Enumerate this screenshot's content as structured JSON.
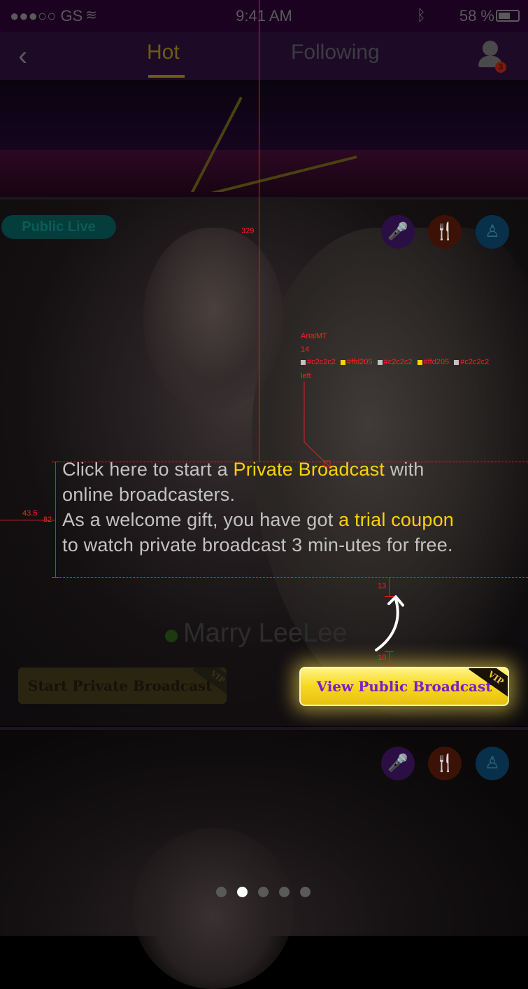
{
  "status_bar": {
    "carrier": "●●●○○ GS",
    "time": "9:41 AM",
    "battery": "58 %"
  },
  "nav": {
    "back_icon": "chevron-left-icon",
    "tabs": [
      "Hot",
      "Following"
    ],
    "active_tab": "Hot",
    "user_badge": "3"
  },
  "feed": {
    "live_badge": "Public Live",
    "broadcaster_name": "Marry LeeLee",
    "category_icons": [
      "microphone-icon",
      "fork-knife-icon",
      "yoga-icon"
    ],
    "private_button": "Start Private Broadcast",
    "vip_label": "VIP"
  },
  "guide": {
    "seg1": "Click here to start a ",
    "seg2": "Private Broadcast",
    "seg3": " with online broadcasters.",
    "seg4": "As a welcome gift, you have got ",
    "seg5": "a trial coupon",
    "seg6": " to watch private broadcast 3 min-utes for free."
  },
  "highlight_button": {
    "label": "View Public Broadcast",
    "vip_label": "VIP"
  },
  "spec_annotations": {
    "font_name": "ArialMT",
    "font_size": "14",
    "colors": [
      "#c2c2c2",
      "#ffd205",
      "#c2c2c2",
      "#ffd205",
      "#c2c2c2"
    ],
    "align": "left",
    "spacing_top": "329",
    "spacing_left": "43.5",
    "text_height": "82",
    "gap_above_arrow": "13",
    "gap_below_arrow": "10"
  },
  "colors": {
    "text_gray": "#c2c2c2",
    "highlight_yellow": "#ffd205",
    "button_text_purple": "#7a1ec8",
    "annotation_red": "#ff2020"
  },
  "pager": {
    "count": 5,
    "active_index": 1
  }
}
